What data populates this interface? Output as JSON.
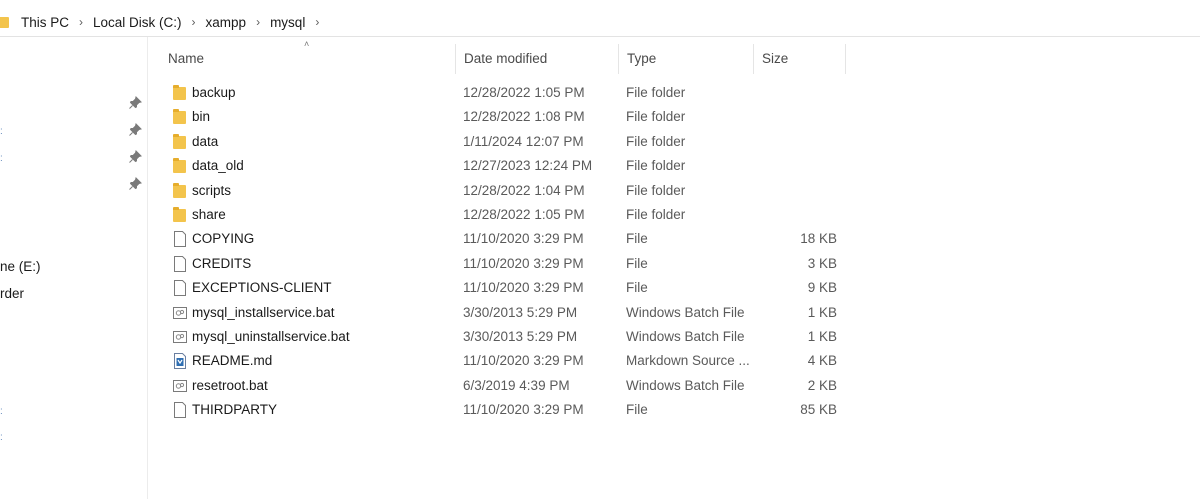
{
  "address": {
    "crumbs": [
      "This PC",
      "Local Disk (C:)",
      "xampp",
      "mysql"
    ]
  },
  "navpane": {
    "fragments": [
      "ne (E:)",
      "rder"
    ]
  },
  "columns": {
    "name": "Name",
    "date": "Date modified",
    "type": "Type",
    "size": "Size"
  },
  "files": [
    {
      "name": "backup",
      "date": "12/28/2022 1:05 PM",
      "type": "File folder",
      "size": "",
      "icon": "folder-icon"
    },
    {
      "name": "bin",
      "date": "12/28/2022 1:08 PM",
      "type": "File folder",
      "size": "",
      "icon": "folder-icon"
    },
    {
      "name": "data",
      "date": "1/11/2024 12:07 PM",
      "type": "File folder",
      "size": "",
      "icon": "folder-icon"
    },
    {
      "name": "data_old",
      "date": "12/27/2023 12:24 PM",
      "type": "File folder",
      "size": "",
      "icon": "folder-icon"
    },
    {
      "name": "scripts",
      "date": "12/28/2022 1:04 PM",
      "type": "File folder",
      "size": "",
      "icon": "folder-icon"
    },
    {
      "name": "share",
      "date": "12/28/2022 1:05 PM",
      "type": "File folder",
      "size": "",
      "icon": "folder-icon"
    },
    {
      "name": "COPYING",
      "date": "11/10/2020 3:29 PM",
      "type": "File",
      "size": "18 KB",
      "icon": "file-icon"
    },
    {
      "name": "CREDITS",
      "date": "11/10/2020 3:29 PM",
      "type": "File",
      "size": "3 KB",
      "icon": "file-icon"
    },
    {
      "name": "EXCEPTIONS-CLIENT",
      "date": "11/10/2020 3:29 PM",
      "type": "File",
      "size": "9 KB",
      "icon": "file-icon"
    },
    {
      "name": "mysql_installservice.bat",
      "date": "3/30/2013 5:29 PM",
      "type": "Windows Batch File",
      "size": "1 KB",
      "icon": "batch-file-icon"
    },
    {
      "name": "mysql_uninstallservice.bat",
      "date": "3/30/2013 5:29 PM",
      "type": "Windows Batch File",
      "size": "1 KB",
      "icon": "batch-file-icon"
    },
    {
      "name": "README.md",
      "date": "11/10/2020 3:29 PM",
      "type": "Markdown Source ...",
      "size": "4 KB",
      "icon": "markdown-file-icon"
    },
    {
      "name": "resetroot.bat",
      "date": "6/3/2019 4:39 PM",
      "type": "Windows Batch File",
      "size": "2 KB",
      "icon": "batch-file-icon"
    },
    {
      "name": "THIRDPARTY",
      "date": "11/10/2020 3:29 PM",
      "type": "File",
      "size": "85 KB",
      "icon": "file-icon"
    }
  ],
  "colors": {
    "folder": "#f3c44c",
    "folder_tab": "#e6ad2c",
    "pin": "#7a7a7a",
    "text": "#1a1a1a",
    "muted_text": "#5a5a5a"
  }
}
